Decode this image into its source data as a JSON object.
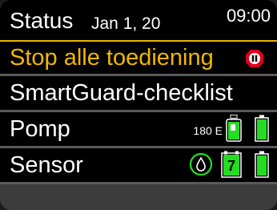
{
  "header": {
    "title": "Status",
    "date": "Jan 1, 20",
    "time": "09:00"
  },
  "menu": {
    "stop": {
      "label": "Stop alle toediening",
      "icon": "pause-stop-icon"
    },
    "checklist": {
      "label": "SmartGuard-checklist"
    },
    "pump": {
      "label": "Pomp",
      "reservoir": "180 E",
      "reservoir_icon": "insulin-reservoir-icon",
      "battery_icon": "pump-battery-icon"
    },
    "sensor": {
      "label": "Sensor",
      "calibration_icon": "calibration-drop-icon",
      "sensor_days": "7",
      "battery_icon": "transmitter-battery-icon"
    }
  },
  "colors": {
    "highlight": "#e8b400",
    "stop_red": "#e0001b",
    "status_green": "#22dd22",
    "background": "#000000"
  }
}
